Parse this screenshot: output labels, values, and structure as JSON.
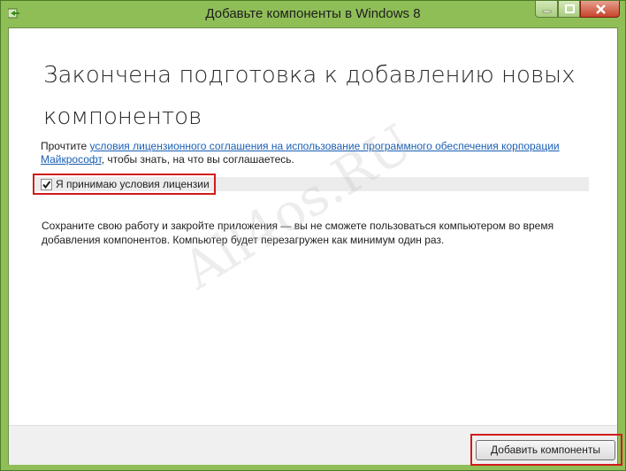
{
  "window": {
    "title": "Добавьте компоненты в Windows 8",
    "app_icon": "green-arrow-icon",
    "controls": [
      "minimize-icon",
      "maximize-icon",
      "close-icon"
    ]
  },
  "main": {
    "heading": "Закончена подготовка к добавлению новых компонентов",
    "license_prefix": "Прочтите ",
    "license_link": "условия лицензионного соглашения на использование программного обеспечения корпорации Майкрософт",
    "license_suffix": ", чтобы знать, на что вы соглашаетесь.",
    "accept_label": "Я принимаю условия лицензии",
    "accept_checked": true,
    "notice": "Сохраните свою работу и закройте приложения — вы не сможете пользоваться компьютером во время добавления компонентов. Компьютер будет перезагружен как минимум один раз."
  },
  "footer": {
    "add_button_label": "Добавить компоненты"
  },
  "watermark": "All4os.RU",
  "colors": {
    "frame": "#8fbe57",
    "link": "#1a5fb4",
    "highlight": "#d11b1b",
    "close_button": "#c7432b"
  }
}
